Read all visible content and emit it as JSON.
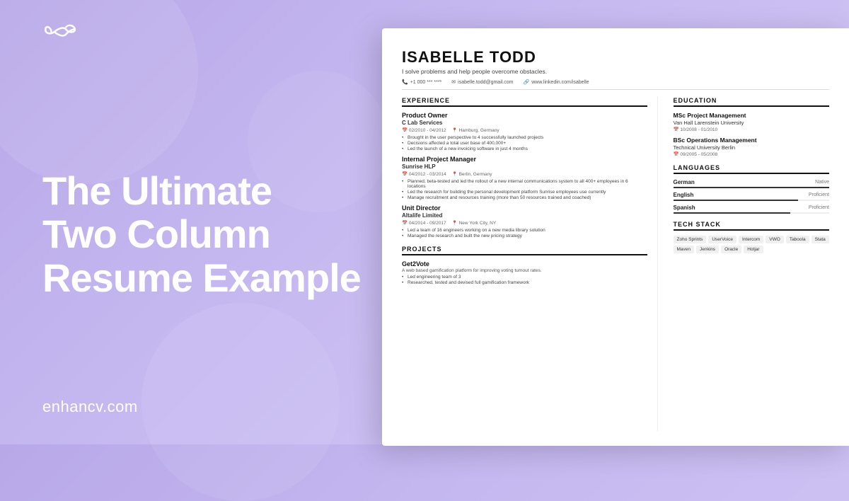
{
  "background": {
    "gradient_start": "#b8a8e8",
    "gradient_end": "#d4c8f5"
  },
  "logo": {
    "alt": "enhancv logo"
  },
  "left_panel": {
    "headline_line1": "The Ultimate",
    "headline_line2": "Two Column",
    "headline_line3": "Resume Example",
    "site_url": "enhancv.com"
  },
  "resume": {
    "name": "ISABELLE TODD",
    "tagline": "I solve problems and help people overcome obstacles.",
    "contact": {
      "phone": "+1 000 *** ****",
      "email": "isabelle.todd@gmail.com",
      "linkedin": "www.linkedin.com/isabelle"
    },
    "experience_title": "EXPERIENCE",
    "jobs": [
      {
        "title": "Product Owner",
        "company": "C Lab Services",
        "dates": "02/2010 - 04/2012",
        "location": "Hamburg, Germany",
        "bullets": [
          "Brought in the user perspective to 4 successfully launched projects",
          "Decisions affected a total user base of 400,000+",
          "Led the launch of a new invoicing software in just 4 months"
        ]
      },
      {
        "title": "Internal Project Manager",
        "company": "Sunrise HLP",
        "dates": "04/2012 - 03/2014",
        "location": "Berlin, Germany",
        "bullets": [
          "Planned, beta-tested and led the rollout of a new internal communications system to all 400+ employees in 6 locations",
          "Led the research for building the personal development platform Sunrise employees use currently",
          "Manage recruitment and resources training (more than 50 resources trained and coached)"
        ]
      },
      {
        "title": "Unit Director",
        "company": "Altalife Limited",
        "dates": "04/2014 - 09/2017",
        "location": "New York City, NY",
        "bullets": [
          "Led a team of 16 engineers working on a new media library solution",
          "Managed the research and built the new pricing strategy"
        ]
      }
    ],
    "projects_title": "PROJECTS",
    "projects": [
      {
        "title": "Get2Vote",
        "description": "A web based gamification platform for improving voting turnout rates.",
        "bullets": [
          "Led engineering team of 3",
          "Researched, tested and devised full gamification framework"
        ]
      }
    ],
    "education_title": "EDUCATION",
    "education": [
      {
        "degree": "MSc Project Management",
        "university": "Van Hall Larenstein University",
        "dates": "10/2008 - 01/2010"
      },
      {
        "degree": "BSc Operations Management",
        "university": "Technical University Berlin",
        "dates": "09/2005 - 05/2008"
      }
    ],
    "languages_title": "LANGUAGES",
    "languages": [
      {
        "name": "German",
        "level": "Native",
        "fill_pct": 100
      },
      {
        "name": "English",
        "level": "Proficient",
        "fill_pct": 80
      },
      {
        "name": "Spanish",
        "level": "Proficient",
        "fill_pct": 75
      }
    ],
    "techstack_title": "TECH STACK",
    "tech_tags": [
      "Zoho Sprints",
      "UserVoice",
      "Intercom",
      "VWO",
      "Taboola",
      "Stata",
      "Maven",
      "Jenkins",
      "Oracle",
      "Hotjar"
    ]
  }
}
